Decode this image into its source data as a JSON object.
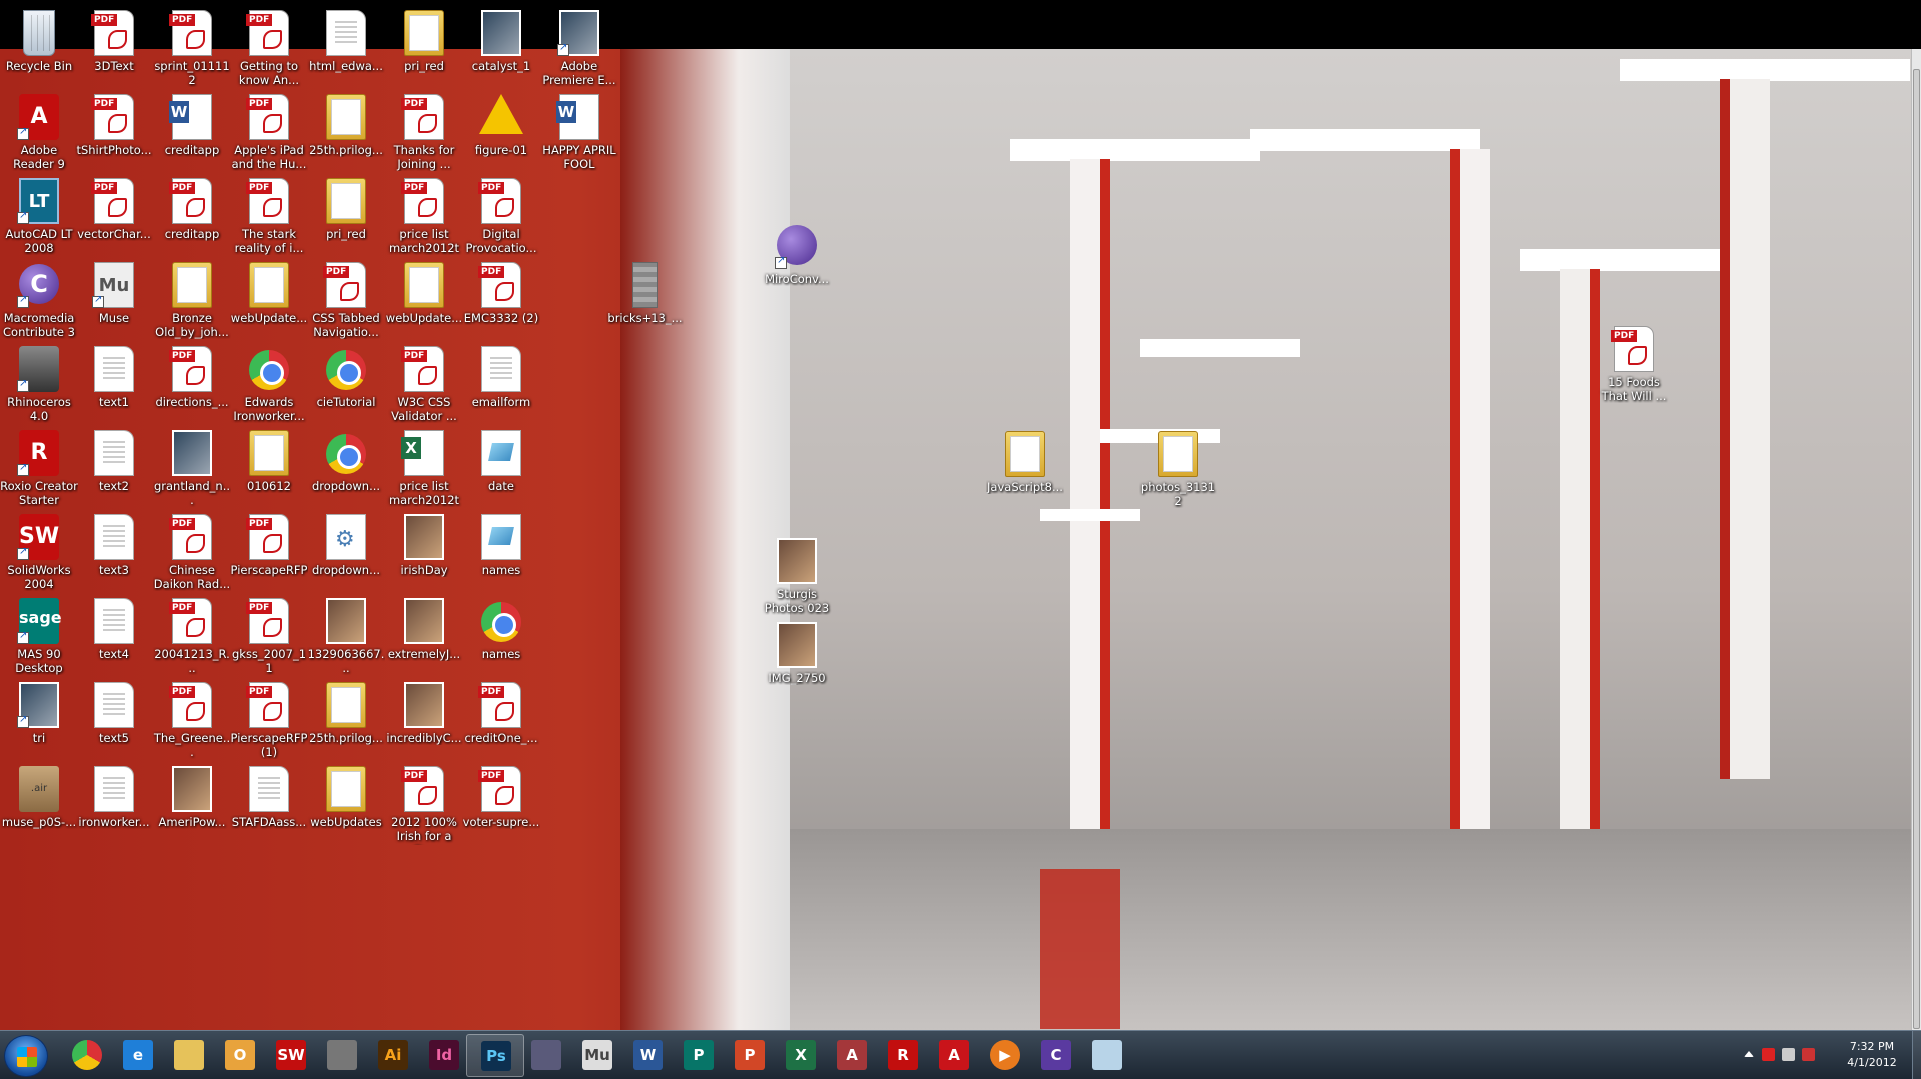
{
  "desktop": {
    "icons": [
      {
        "label": "Recycle Bin",
        "icon": "recycle-bin"
      },
      {
        "label": "3DText",
        "icon": "pdf"
      },
      {
        "label": "sprint_011112",
        "icon": "pdf"
      },
      {
        "label": "Getting to know An...",
        "icon": "pdf"
      },
      {
        "label": "html_edwa...",
        "icon": "document"
      },
      {
        "label": "pri_red",
        "icon": "folder"
      },
      {
        "label": "catalyst_1",
        "icon": "video"
      },
      {
        "label": "Adobe Premiere E...",
        "icon": "premiere"
      },
      {
        "label": "Adobe Reader 9",
        "icon": "acrobat"
      },
      {
        "label": "tShirtPhoto...",
        "icon": "pdf"
      },
      {
        "label": "creditapp",
        "icon": "word"
      },
      {
        "label": "Apple's iPad and the Hu...",
        "icon": "pdf"
      },
      {
        "label": "25th.prilog...",
        "icon": "folder"
      },
      {
        "label": "Thanks for Joining ...",
        "icon": "pdf"
      },
      {
        "label": "figure-01",
        "icon": "warning"
      },
      {
        "label": "HAPPY APRIL FOOL",
        "icon": "word"
      },
      {
        "label": "AutoCAD LT 2008",
        "icon": "autocad"
      },
      {
        "label": "vectorChar...",
        "icon": "pdf"
      },
      {
        "label": "creditapp",
        "icon": "pdf"
      },
      {
        "label": "The stark reality of i...",
        "icon": "pdf"
      },
      {
        "label": "pri_red",
        "icon": "folder"
      },
      {
        "label": "price list march2012t",
        "icon": "pdf"
      },
      {
        "label": "Digital Provocatio...",
        "icon": "pdf"
      },
      {
        "label": "Macromedia Contribute 3",
        "icon": "contribute"
      },
      {
        "label": "Muse",
        "icon": "muse"
      },
      {
        "label": "Bronze Old_by_joh...",
        "icon": "folder"
      },
      {
        "label": "webUpdate...",
        "icon": "folder"
      },
      {
        "label": "CSS Tabbed Navigatio...",
        "icon": "pdf"
      },
      {
        "label": "webUpdate...",
        "icon": "folder"
      },
      {
        "label": "EMC3332 (2)",
        "icon": "pdf"
      },
      {
        "label": "bricks+13_...",
        "icon": "bricks"
      },
      {
        "label": "Rhinoceros 4.0",
        "icon": "rhino"
      },
      {
        "label": "text1",
        "icon": "document"
      },
      {
        "label": "directions_...",
        "icon": "pdf"
      },
      {
        "label": "Edwards Ironworker...",
        "icon": "chrome"
      },
      {
        "label": "cieTutorial",
        "icon": "chrome"
      },
      {
        "label": "W3C CSS Validator ...",
        "icon": "pdf"
      },
      {
        "label": "emailform",
        "icon": "document"
      },
      {
        "label": "Roxio Creator Starter",
        "icon": "roxio"
      },
      {
        "label": "text2",
        "icon": "document"
      },
      {
        "label": "grantland_n...",
        "icon": "image"
      },
      {
        "label": "010612",
        "icon": "folder"
      },
      {
        "label": "dropdown...",
        "icon": "chrome"
      },
      {
        "label": "price list march2012t",
        "icon": "excel"
      },
      {
        "label": "date",
        "icon": "textsheet"
      },
      {
        "label": "SolidWorks 2004",
        "icon": "solidworks"
      },
      {
        "label": "text3",
        "icon": "document"
      },
      {
        "label": "Chinese Daikon Rad...",
        "icon": "pdf"
      },
      {
        "label": "PierscapeRFP",
        "icon": "pdf"
      },
      {
        "label": "dropdown...",
        "icon": "gear-doc"
      },
      {
        "label": "irishDay",
        "icon": "photo"
      },
      {
        "label": "names",
        "icon": "textsheet"
      },
      {
        "label": "MAS 90 Desktop",
        "icon": "sage"
      },
      {
        "label": "text4",
        "icon": "document"
      },
      {
        "label": "20041213_R...",
        "icon": "pdf"
      },
      {
        "label": "gkss_2007_11",
        "icon": "pdf"
      },
      {
        "label": "1329063667...",
        "icon": "photo"
      },
      {
        "label": "extremelyJ...",
        "icon": "photo"
      },
      {
        "label": "names",
        "icon": "chrome"
      },
      {
        "label": "tri",
        "icon": "window"
      },
      {
        "label": "text5",
        "icon": "document"
      },
      {
        "label": "The_Greene...",
        "icon": "pdf"
      },
      {
        "label": "PierscapeRFP (1)",
        "icon": "pdf"
      },
      {
        "label": "25th.prilog...",
        "icon": "folder"
      },
      {
        "label": "incrediblyC...",
        "icon": "photo"
      },
      {
        "label": "creditOne_...",
        "icon": "pdf"
      },
      {
        "label": "muse_p0S-...",
        "icon": "air-package"
      },
      {
        "label": "ironworker...",
        "icon": "document"
      },
      {
        "label": "AmeriPow...",
        "icon": "photo"
      },
      {
        "label": "STAFDAass...",
        "icon": "document"
      },
      {
        "label": "webUpdates",
        "icon": "folder"
      },
      {
        "label": "2012 100% Irish for a D...",
        "icon": "pdf"
      },
      {
        "label": "voter-supre...",
        "icon": "pdf"
      },
      {
        "label": "MiroConv...",
        "icon": "miro"
      },
      {
        "label": "Sturgis Photos 023",
        "icon": "photo"
      },
      {
        "label": "IMG_2750",
        "icon": "photo"
      },
      {
        "label": "JavaScript8...",
        "icon": "folder"
      },
      {
        "label": "photos_31312",
        "icon": "folder"
      },
      {
        "label": "15 Foods That Will ...",
        "icon": "pdf"
      }
    ]
  },
  "taskbar": {
    "pinned": [
      {
        "name": "chrome",
        "text": ""
      },
      {
        "name": "internet-explorer",
        "text": "e"
      },
      {
        "name": "explorer",
        "text": ""
      },
      {
        "name": "outlook",
        "text": "O"
      },
      {
        "name": "solidworks",
        "text": "SW"
      },
      {
        "name": "rhino",
        "text": ""
      },
      {
        "name": "illustrator",
        "text": "Ai"
      },
      {
        "name": "indesign",
        "text": "Id"
      },
      {
        "name": "photoshop",
        "text": "Ps"
      },
      {
        "name": "premiere",
        "text": ""
      },
      {
        "name": "muse",
        "text": "Mu"
      },
      {
        "name": "word",
        "text": "W"
      },
      {
        "name": "publisher",
        "text": "P"
      },
      {
        "name": "powerpoint",
        "text": "P"
      },
      {
        "name": "excel",
        "text": "X"
      },
      {
        "name": "access",
        "text": "A"
      },
      {
        "name": "roxio",
        "text": "R"
      },
      {
        "name": "acrobat",
        "text": "A"
      },
      {
        "name": "media-player",
        "text": "▶"
      },
      {
        "name": "contribute",
        "text": "C"
      },
      {
        "name": "notes",
        "text": ""
      }
    ],
    "clock": {
      "time": "7:32 PM",
      "date": "4/1/2012"
    }
  }
}
